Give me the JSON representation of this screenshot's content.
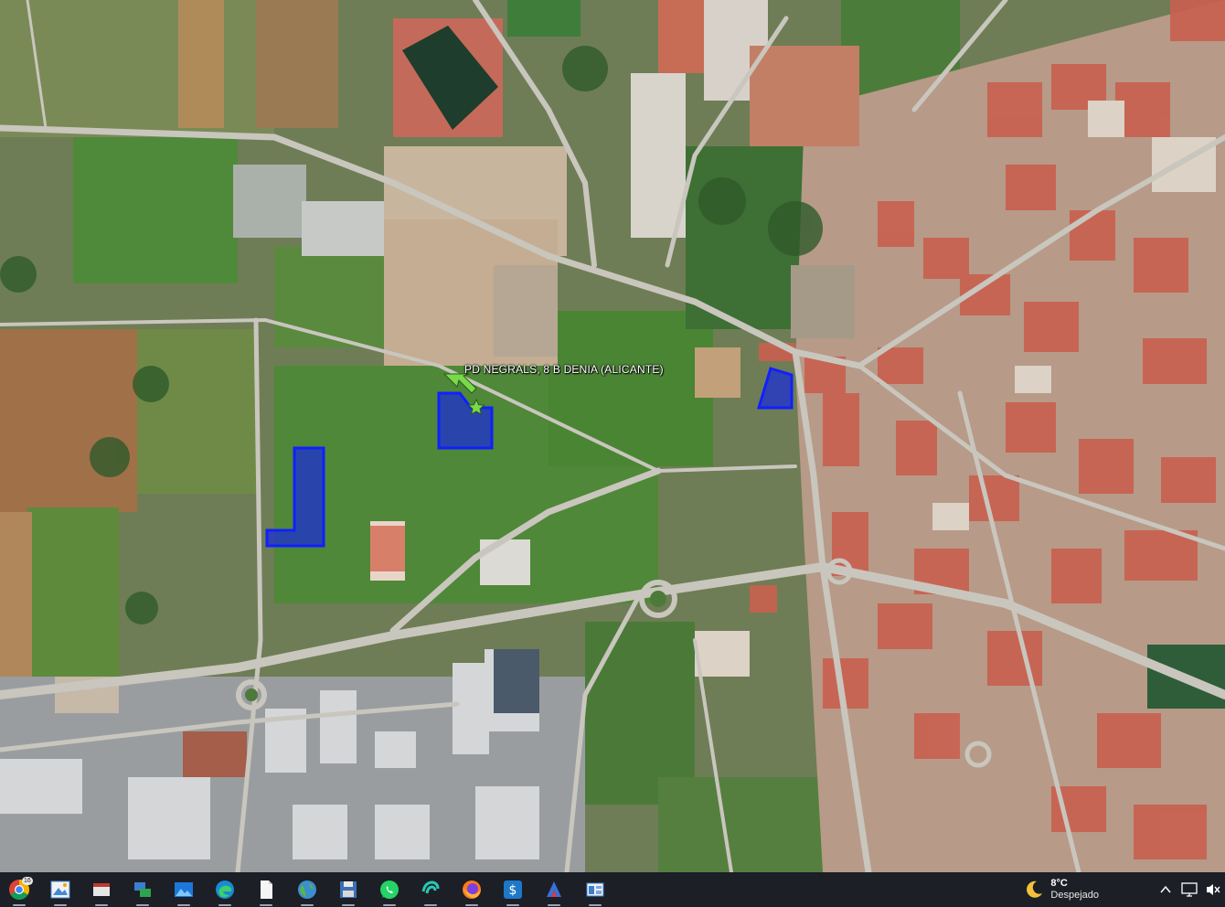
{
  "map": {
    "marker_label": "PD NEGRALS, 8 B DENIA (ALICANTE)",
    "parcel_color": "#1a2bd8",
    "parcel_stroke": "#1020ff",
    "marker_color": "#7ad94a"
  },
  "taskbar": {
    "apps": [
      {
        "name": "chrome-icon",
        "badge": "16"
      },
      {
        "name": "photo-viewer-icon"
      },
      {
        "name": "snipping-tool-icon"
      },
      {
        "name": "network-share-icon"
      },
      {
        "name": "photos-gallery-icon"
      },
      {
        "name": "edge-icon"
      },
      {
        "name": "blank-document-icon"
      },
      {
        "name": "globe-icon"
      },
      {
        "name": "floppy-save-icon"
      },
      {
        "name": "whatsapp-icon"
      },
      {
        "name": "swirl-app-icon"
      },
      {
        "name": "firefox-icon"
      },
      {
        "name": "dollar-app-icon"
      },
      {
        "name": "arrow-app-icon"
      },
      {
        "name": "window-app-icon"
      }
    ],
    "weather": {
      "temperature": "8°C",
      "condition": "Despejado",
      "icon": "moon-icon"
    },
    "tray": [
      "chevron-up-icon",
      "display-icon",
      "volume-icon"
    ]
  }
}
